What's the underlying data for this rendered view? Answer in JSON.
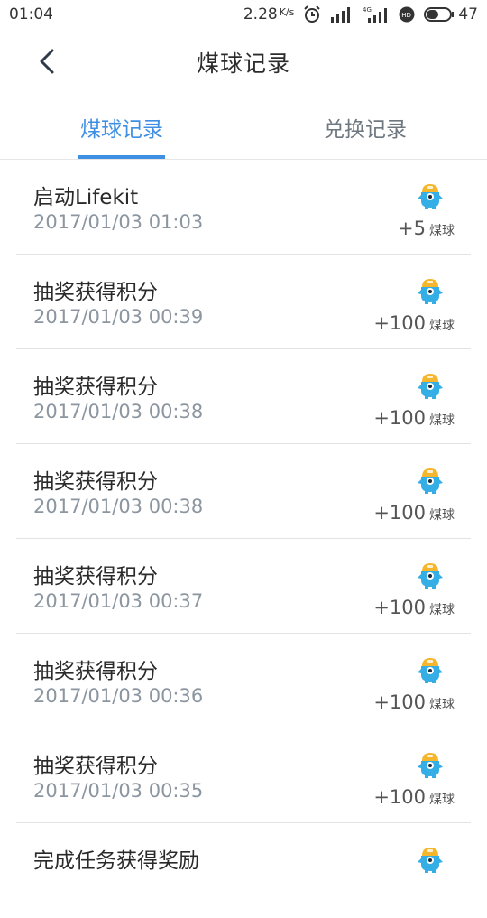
{
  "status_bar": {
    "time": "01:04",
    "speed_value": "2.28",
    "speed_unit": "K/s",
    "battery": "47",
    "icons": [
      "alarm-icon",
      "signal-icon",
      "signal-4g-icon",
      "hd-icon",
      "battery-icon"
    ]
  },
  "header": {
    "title": "煤球记录"
  },
  "tabs": [
    {
      "label": "煤球记录",
      "active": true
    },
    {
      "label": "兑换记录",
      "active": false
    }
  ],
  "colors": {
    "accent": "#3f8fe3",
    "mascot_body": "#35aee6",
    "mascot_helmet": "#f6b62b"
  },
  "records": [
    {
      "title": "启动Lifekit",
      "time": "2017/01/03 01:03",
      "amount": "+5",
      "unit": "煤球"
    },
    {
      "title": "抽奖获得积分",
      "time": "2017/01/03 00:39",
      "amount": "+100",
      "unit": "煤球"
    },
    {
      "title": "抽奖获得积分",
      "time": "2017/01/03 00:38",
      "amount": "+100",
      "unit": "煤球"
    },
    {
      "title": "抽奖获得积分",
      "time": "2017/01/03 00:38",
      "amount": "+100",
      "unit": "煤球"
    },
    {
      "title": "抽奖获得积分",
      "time": "2017/01/03 00:37",
      "amount": "+100",
      "unit": "煤球"
    },
    {
      "title": "抽奖获得积分",
      "time": "2017/01/03 00:36",
      "amount": "+100",
      "unit": "煤球"
    },
    {
      "title": "抽奖获得积分",
      "time": "2017/01/03 00:35",
      "amount": "+100",
      "unit": "煤球"
    },
    {
      "title": "完成任务获得奖励",
      "time": "",
      "amount": "",
      "unit": ""
    }
  ]
}
